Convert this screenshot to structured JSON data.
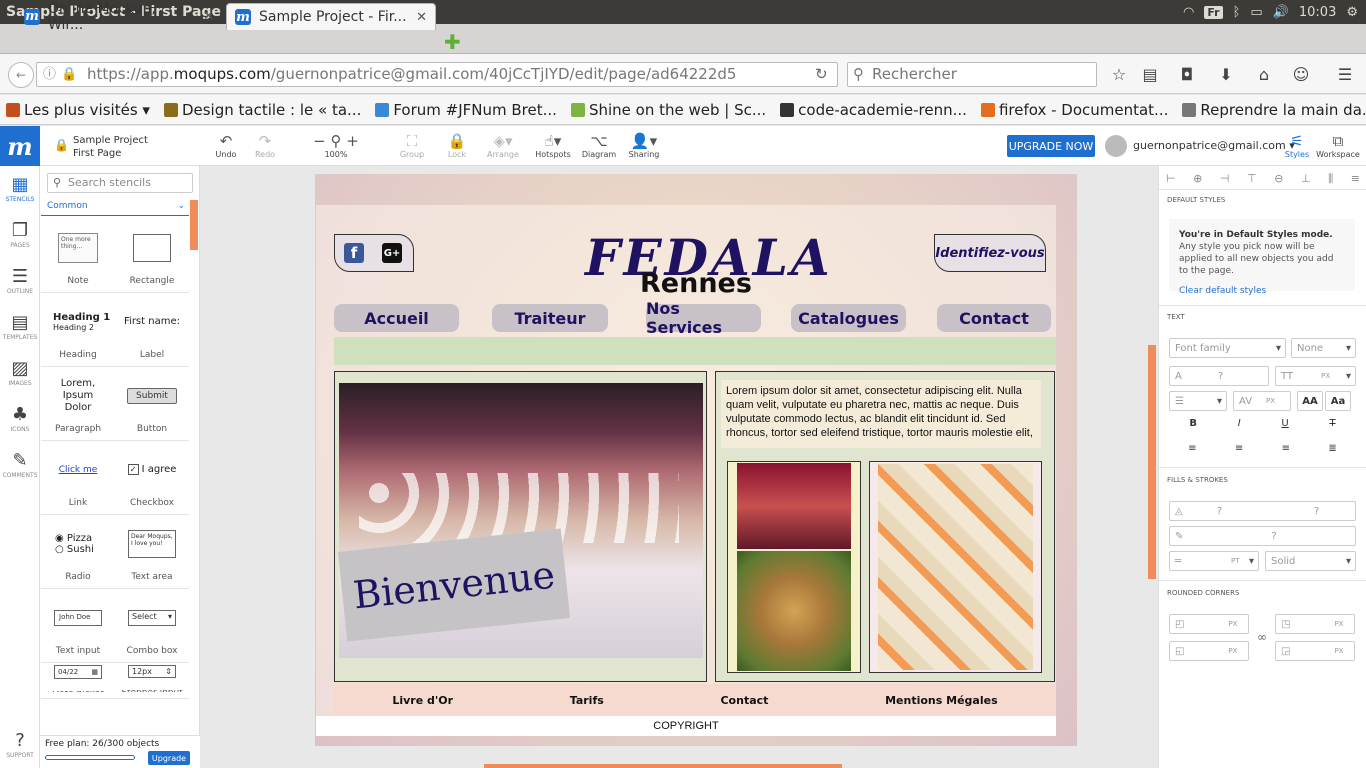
{
  "os": {
    "window_title": "Sample Project - First Page · Moqups - Mozilla Firefox",
    "kb_layout": "Fr",
    "clock": "10:03"
  },
  "tabs": [
    {
      "label": "Online Mockup, Wir...",
      "close": "✕"
    },
    {
      "label": "Sample Project - Fir...",
      "close": "✕"
    }
  ],
  "nav": {
    "url_host": "https://app.",
    "url_domain": "moqups.com",
    "url_path": "/guernonpatrice@gmail.com/40jCcTjIYD/edit/page/ad64222d5",
    "search_placeholder": "Rechercher"
  },
  "bookmarks": [
    {
      "label": "Les plus visités ▾",
      "color": "#c1501f"
    },
    {
      "label": "Design tactile : le « ta...",
      "color": "#8a6d1a"
    },
    {
      "label": "Forum #JFNum Bret...",
      "color": "#3a88d6"
    },
    {
      "label": "Shine on the web | Sc...",
      "color": "#7cb342"
    },
    {
      "label": "code-academie-renn...",
      "color": "#333333"
    },
    {
      "label": "firefox - Documentat...",
      "color": "#e36f1e"
    },
    {
      "label": "Reprendre la main da...",
      "color": "#777777"
    }
  ],
  "app": {
    "project": "Sample Project",
    "page": "First Page",
    "tools": [
      {
        "label": "Undo",
        "icon": "↶"
      },
      {
        "label": "Redo",
        "icon": "↷"
      },
      {
        "label": "100%",
        "icon": "− ⚲ +"
      },
      {
        "label": "Group",
        "icon": "⛶"
      },
      {
        "label": "Lock",
        "icon": "🔒"
      },
      {
        "label": "Arrange",
        "icon": "◈▾"
      },
      {
        "label": "Hotspots",
        "icon": "☝▾"
      },
      {
        "label": "Diagram",
        "icon": "⌥"
      },
      {
        "label": "Sharing",
        "icon": "👤▾"
      }
    ],
    "upgrade_label": "UPGRADE NOW",
    "user_email": "guernonpatrice@gmail.com ▾",
    "styles_label": "Styles",
    "workspace_label": "Workspace"
  },
  "rail": [
    {
      "label": "STENCILS",
      "icon": "▦"
    },
    {
      "label": "PAGES",
      "icon": "❐"
    },
    {
      "label": "OUTLINE",
      "icon": "☰"
    },
    {
      "label": "TEMPLATES",
      "icon": "▤"
    },
    {
      "label": "IMAGES",
      "icon": "▨"
    },
    {
      "label": "ICONS",
      "icon": "♣"
    },
    {
      "label": "COMMENTS",
      "icon": "✎"
    },
    {
      "label": "SUPPORT",
      "icon": "?"
    }
  ],
  "stencils": {
    "search_placeholder": "Search stencils",
    "category": "Common",
    "items": [
      {
        "label": "Note",
        "preview": "One more thing..."
      },
      {
        "label": "Rectangle",
        "preview": ""
      },
      {
        "label": "Heading",
        "preview": "Heading 1",
        "preview2": "Heading 2"
      },
      {
        "label": "Label",
        "preview": "First name:"
      },
      {
        "label": "Paragraph",
        "preview": "Lorem, Ipsum Dolor"
      },
      {
        "label": "Button",
        "preview": "Submit"
      },
      {
        "label": "Link",
        "preview": "Click me"
      },
      {
        "label": "Checkbox",
        "preview": "I agree"
      },
      {
        "label": "Radio",
        "preview": "Pizza",
        "preview2": "Sushi"
      },
      {
        "label": "Text area",
        "preview": "Dear Moqups, I love you!"
      },
      {
        "label": "Text input",
        "preview": "John Doe"
      },
      {
        "label": "Combo box",
        "preview": "Select"
      },
      {
        "label": "Date picker",
        "preview": "04/22"
      },
      {
        "label": "Stepper input",
        "preview": "12px"
      }
    ],
    "free_plan": "Free plan: 26/300 objects",
    "upgrade_small": "Upgrade"
  },
  "mockup": {
    "brand": "FEDALA",
    "city": "Rennes",
    "login": "Identifiez-vous",
    "menu": [
      "Accueil",
      "Traiteur",
      "Nos Services",
      "Catalogues",
      "Contact"
    ],
    "welcome": "Bienvenue",
    "lorem": "Lorem ipsum dolor sit amet, consectetur adipiscing elit. Nulla quam velit, vulputate eu pharetra nec, mattis ac neque. Duis vulputate commodo lectus, ac blandit elit tincidunt id. Sed rhoncus, tortor sed eleifend tristique, tortor mauris molestie elit,",
    "footer_links": [
      "Livre d'Or",
      "Tarifs",
      "Contact",
      "Mentions Mégales"
    ],
    "copyright": "COPYRIGHT"
  },
  "right_panel": {
    "default_styles": "DEFAULT STYLES",
    "info_title": "You're in Default Styles mode.",
    "info_body": "Any style you pick now will be applied to all new objects you add to the page.",
    "info_link": "Clear default styles",
    "text_title": "TEXT",
    "font_family": "Font family",
    "font_weight": "None",
    "q": "?",
    "px": "PX",
    "pt": "PT",
    "fills_title": "FILLS & STROKES",
    "stroke_style": "Solid",
    "rounded_title": "ROUNDED CORNERS",
    "aa_big": "AA",
    "aa_small": "Aa",
    "fmt_b": "B",
    "fmt_i": "I",
    "fmt_u": "U",
    "fmt_s": "T"
  }
}
